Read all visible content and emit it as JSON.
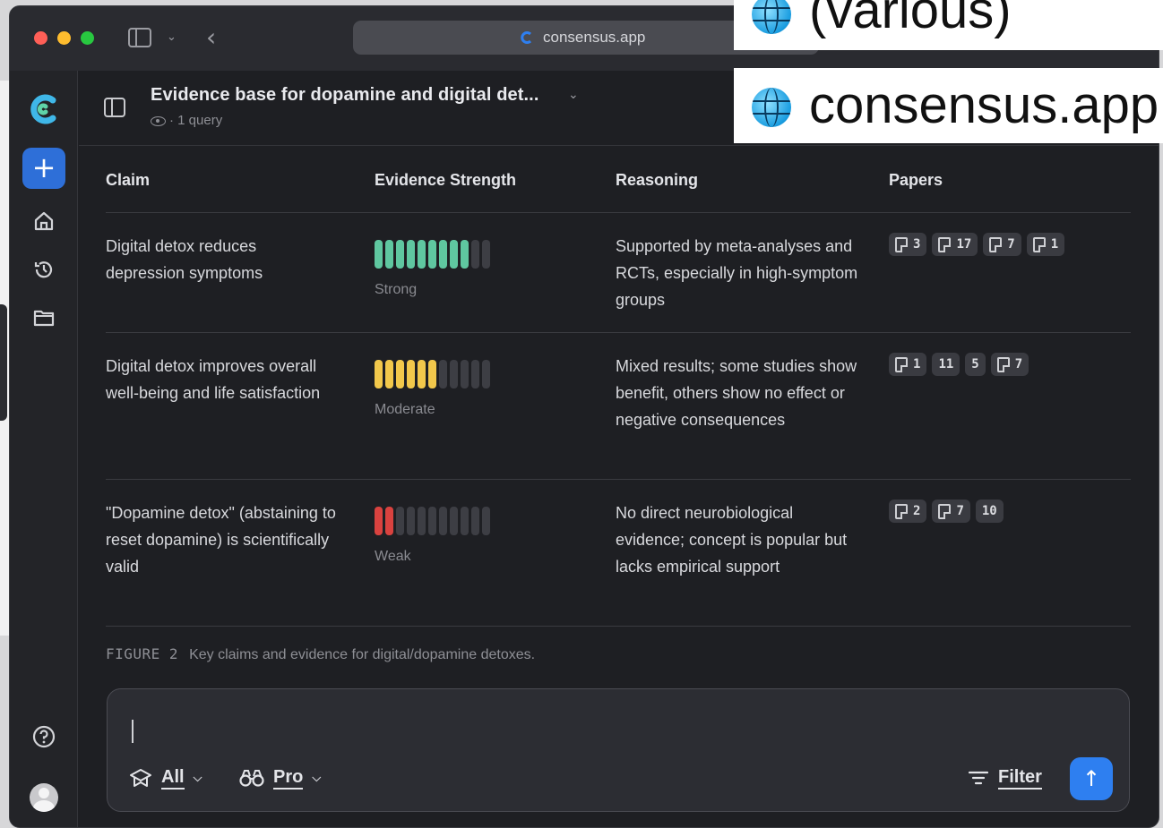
{
  "browser": {
    "url": "consensus.app"
  },
  "overlays": {
    "top_label": "(various)",
    "domain_label": "consensus.app"
  },
  "header": {
    "title": "Evidence base for dopamine and digital det...",
    "subtitle": "· 1 query"
  },
  "table": {
    "columns": [
      "Claim",
      "Evidence Strength",
      "Reasoning",
      "Papers"
    ],
    "rows": [
      {
        "claim": "Digital detox reduces depression symptoms",
        "strength_label": "Strong",
        "strength_level": 9,
        "strength_total": 11,
        "strength_color": "#5fc7a0",
        "reasoning": "Supported by meta-analyses and RCTs, especially in high-symptom groups",
        "papers": [
          {
            "icon": "document-icon",
            "count": "3"
          },
          {
            "icon": "document-icon",
            "count": "17"
          },
          {
            "icon": "document-icon",
            "count": "7"
          },
          {
            "icon": "document-icon",
            "count": "1"
          }
        ]
      },
      {
        "claim": "Digital detox improves overall well-being and life satisfaction",
        "strength_label": "Moderate",
        "strength_level": 6,
        "strength_total": 11,
        "strength_color": "#f2c84b",
        "reasoning": "Mixed results; some studies show benefit, others show no effect or negative consequences",
        "papers": [
          {
            "icon": "document-icon",
            "count": "1"
          },
          {
            "icon": "",
            "count": "11"
          },
          {
            "icon": "",
            "count": "5"
          },
          {
            "icon": "document-icon",
            "count": "7"
          }
        ]
      },
      {
        "claim": "\"Dopamine detox\" (abstaining to reset dopamine) is scientifically valid",
        "strength_label": "Weak",
        "strength_level": 2,
        "strength_total": 11,
        "strength_color": "#d9423f",
        "reasoning": "No direct neurobiological evidence; concept is popular but lacks empirical support",
        "papers": [
          {
            "icon": "document-icon",
            "count": "2"
          },
          {
            "icon": "document-icon",
            "count": "7"
          },
          {
            "icon": "",
            "count": "10"
          }
        ]
      }
    ]
  },
  "figure": {
    "tag": "FIGURE 2",
    "caption": "Key claims and evidence for digital/dopamine detoxes."
  },
  "composer": {
    "scope_label": "All",
    "mode_label": "Pro",
    "filter_label": "Filter"
  },
  "colors": {
    "accent": "#2e7ff0",
    "background": "#1e1f23"
  }
}
